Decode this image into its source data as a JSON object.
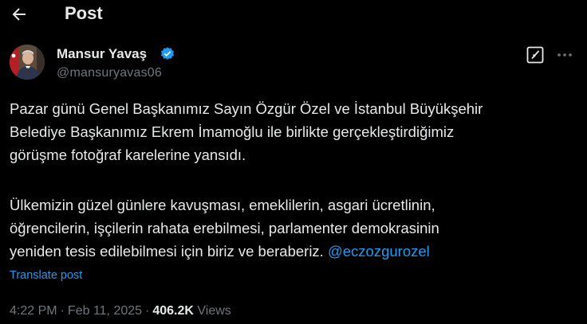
{
  "header": {
    "title": "Post",
    "back_icon": "arrow-left-icon"
  },
  "author": {
    "name": "Mansur Yavaş",
    "handle": "@mansuryavas06",
    "verified_icon": "verified-badge-icon",
    "verified_color": "#1d9bf0"
  },
  "actions": {
    "grok_icon": "grok-icon",
    "more_icon": "more-horizontal-icon"
  },
  "post": {
    "line1": "Pazar günü Genel Başkanımız Sayın Özgür Özel ve İstanbul Büyükşehir",
    "line2": "Belediye Başkanımız Ekrem İmamoğlu ile birlikte gerçekleştirdiğimiz",
    "line3": "görüşme fotoğraf karelerine yansıdı.",
    "line4": "Ülkemizin güzel günlere kavuşması, emeklilerin, asgari ücretlinin,",
    "line5": "öğrencilerin, işçilerin rahata erebilmesi, parlamenter demokrasinin",
    "line6": "yeniden tesis edilebilmesi için biriz ve beraberiz.",
    "mention": "@eczozgurozel"
  },
  "translate_label": "Translate post",
  "meta": {
    "time": "4:22 PM",
    "separator": "·",
    "date": "Feb 11, 2025",
    "views_count": "406.2K",
    "views_label": "Views"
  },
  "colors": {
    "background": "#000000",
    "text": "#e7e9ea",
    "secondary": "#71767b",
    "link": "#1d9bf0"
  }
}
